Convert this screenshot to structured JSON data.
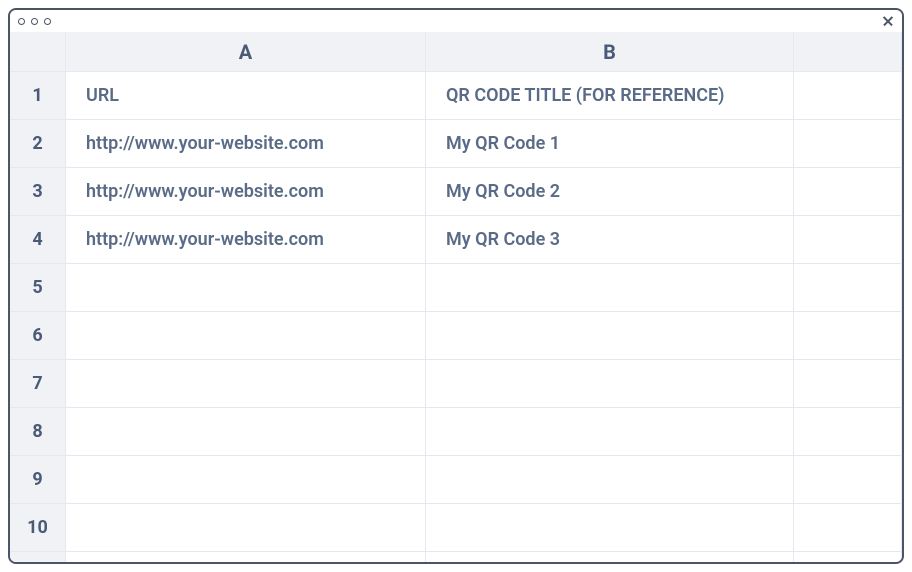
{
  "columns": {
    "a": "A",
    "b": "B"
  },
  "rows": [
    {
      "num": "1",
      "a": "URL",
      "b": "QR CODE TITLE (FOR REFERENCE)"
    },
    {
      "num": "2",
      "a": "http://www.your-website.com",
      "b": "My QR Code 1"
    },
    {
      "num": "3",
      "a": "http://www.your-website.com",
      "b": "My QR Code 2"
    },
    {
      "num": "4",
      "a": "http://www.your-website.com",
      "b": "My QR Code 3"
    },
    {
      "num": "5",
      "a": "",
      "b": ""
    },
    {
      "num": "6",
      "a": "",
      "b": ""
    },
    {
      "num": "7",
      "a": "",
      "b": ""
    },
    {
      "num": "8",
      "a": "",
      "b": ""
    },
    {
      "num": "9",
      "a": "",
      "b": ""
    },
    {
      "num": "10",
      "a": "",
      "b": ""
    }
  ]
}
